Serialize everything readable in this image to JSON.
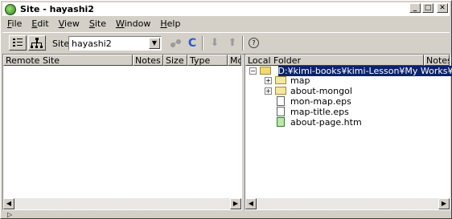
{
  "window": {
    "title": "Site - hayashi2",
    "controls": {
      "minimize": "_",
      "maximize": "□",
      "close": "✕"
    }
  },
  "menu": {
    "items": [
      {
        "label": "File",
        "u": "F",
        "rest": "ile"
      },
      {
        "label": "Edit",
        "u": "E",
        "rest": "dit"
      },
      {
        "label": "View",
        "u": "V",
        "rest": "iew"
      },
      {
        "label": "Site",
        "u": "S",
        "rest": "ite"
      },
      {
        "label": "Window",
        "u": "W",
        "rest": "indow"
      },
      {
        "label": "Help",
        "u": "H",
        "rest": "elp"
      }
    ]
  },
  "toolbar": {
    "site_label": "Site:",
    "site_value": "hayashi2",
    "dropdown_arrow": "▼",
    "icons": [
      "site-files-icon",
      "site-map-icon",
      "connect-icon",
      "refresh-icon",
      "get-icon",
      "put-icon",
      "help-icon"
    ],
    "refresh_glyph": "C",
    "get_glyph": "⬇",
    "put_glyph": "⬆",
    "help_glyph": "?"
  },
  "remote_panel": {
    "columns": [
      "Remote Site",
      "Notes",
      "Size",
      "Type",
      "Moc"
    ],
    "scroll_left": "◀",
    "scroll_right": "▶"
  },
  "local_panel": {
    "columns": [
      "Local Folder",
      "Notes"
    ],
    "root": "D:¥kimi-books¥kimi-Lesson¥My Works¥Ha...",
    "items": [
      {
        "name": "map",
        "type": "folder"
      },
      {
        "name": "about-mongol",
        "type": "folder"
      },
      {
        "name": "mon-map.eps",
        "type": "file"
      },
      {
        "name": "map-title.eps",
        "type": "file"
      },
      {
        "name": "about-page.htm",
        "type": "html"
      }
    ],
    "expand_glyph": "+",
    "collapse_glyph": "−",
    "scroll_left": "◀",
    "scroll_right": "▶"
  },
  "status": {
    "arrow": "▷"
  }
}
